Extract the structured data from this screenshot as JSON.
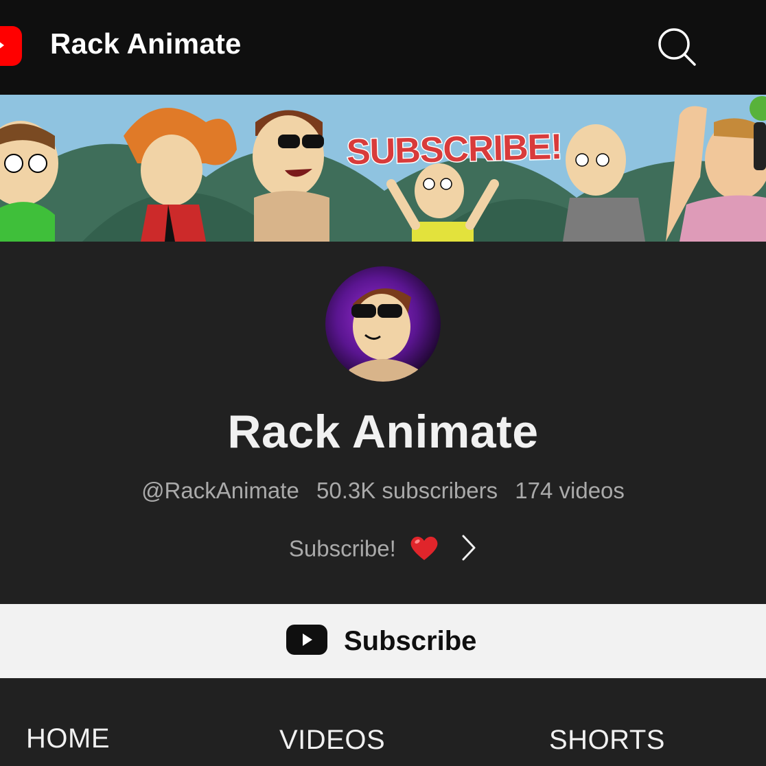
{
  "app": {
    "title": "Rack Animate",
    "logo_icon": "youtube-logo-icon",
    "search_icon": "search-icon"
  },
  "banner": {
    "text": "SUBSCRIBE!"
  },
  "channel": {
    "name": "Rack Animate",
    "handle": "@RackAnimate",
    "subscribers": "50.3K subscribers",
    "videos": "174 videos",
    "tagline": "Subscribe!",
    "tagline_emoji": "heart-emoji-icon",
    "tagline_more_icon": "chevron-right-icon"
  },
  "subscribe": {
    "label": "Subscribe",
    "icon": "youtube-play-icon"
  },
  "tabs": [
    {
      "label": "HOME"
    },
    {
      "label": "VIDEOS"
    },
    {
      "label": "SHORTS"
    }
  ],
  "colors": {
    "topbar_bg": "#0f0f0f",
    "page_bg": "#212121",
    "brand_red": "#ff0000",
    "subscribe_bar_bg": "#f2f2f2",
    "secondary_text": "#aaaaaa"
  }
}
